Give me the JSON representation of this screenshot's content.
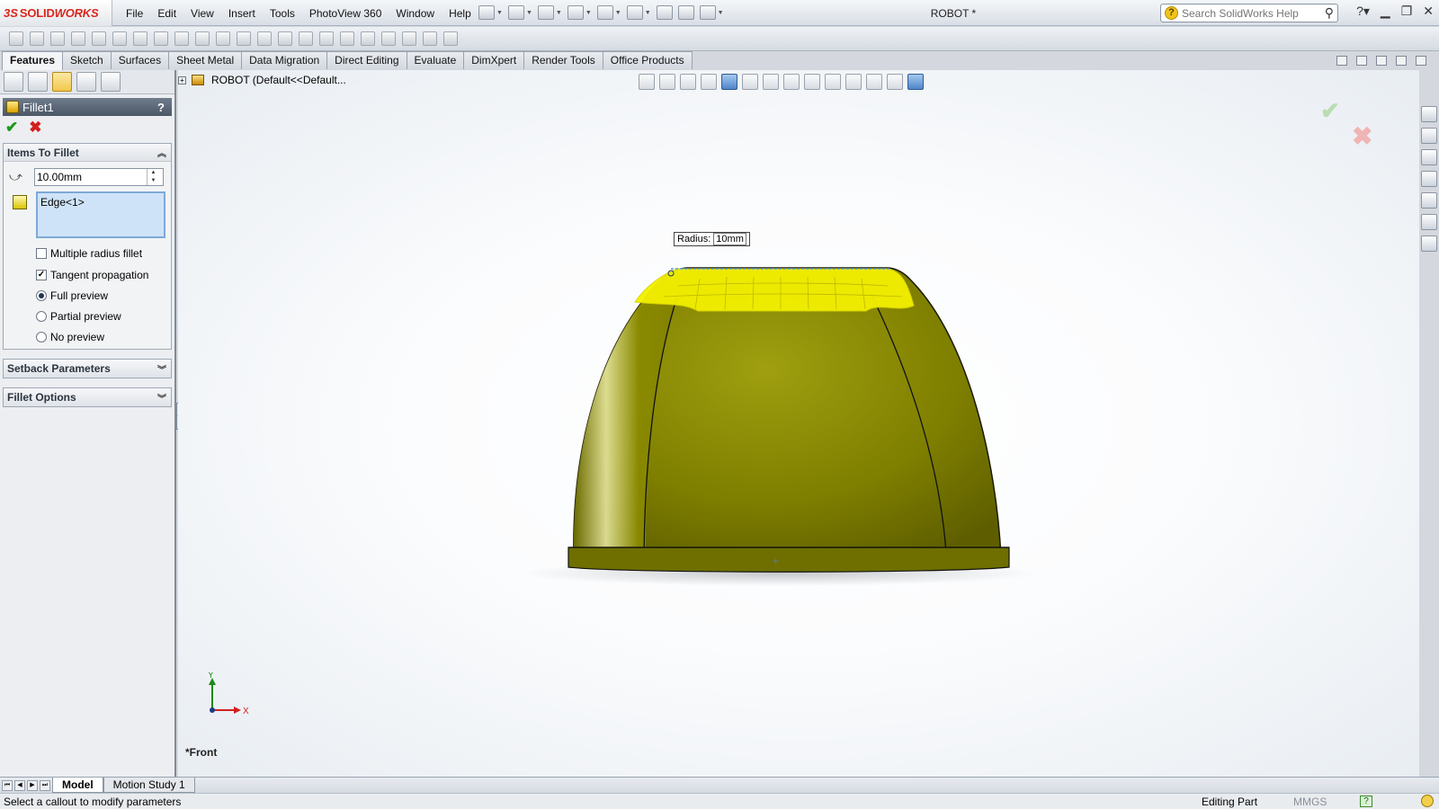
{
  "app": {
    "logo_ds": "3S",
    "logo_a": "SOLID",
    "logo_b": "WORKS",
    "doc_title": "ROBOT *"
  },
  "menu": [
    "File",
    "Edit",
    "View",
    "Insert",
    "Tools",
    "PhotoView 360",
    "Window",
    "Help"
  ],
  "search": {
    "placeholder": "Search SolidWorks Help",
    "help_icon_glyph": "?"
  },
  "tabs": [
    "Features",
    "Sketch",
    "Surfaces",
    "Sheet Metal",
    "Data Migration",
    "Direct Editing",
    "Evaluate",
    "DimXpert",
    "Render Tools",
    "Office Products"
  ],
  "active_tab": "Features",
  "property_manager": {
    "title": "Fillet1",
    "help_glyph": "?",
    "ok_glyph": "✔",
    "cancel_glyph": "✖",
    "items_group": {
      "label": "Items To Fillet",
      "radius_value": "10.00mm",
      "selection": "Edge<1>",
      "multiple_radius_label": "Multiple radius fillet",
      "multiple_radius_checked": false,
      "tangent_label": "Tangent propagation",
      "tangent_checked": true,
      "preview_options": [
        "Full preview",
        "Partial preview",
        "No preview"
      ],
      "preview_selected": "Full preview"
    },
    "setback_label": "Setback Parameters",
    "fillet_options_label": "Fillet Options"
  },
  "tree": {
    "root": "ROBOT  (Default<<Default..."
  },
  "viewport": {
    "view_name": "*Front",
    "callout_label": "Radius:",
    "callout_value": "10mm",
    "triad_x": "X",
    "triad_y": "Y",
    "ok_glyph": "✔",
    "cancel_glyph": "✖"
  },
  "bottom_tabs": [
    "Model",
    "Motion Study 1"
  ],
  "active_bottom_tab": "Model",
  "status": {
    "message": "Select a callout to modify parameters",
    "mode": "Editing Part",
    "units": "MMGS",
    "help_glyph": "?"
  },
  "colors": {
    "part": "#8f8f00",
    "preview": "#f3f000",
    "accent": "#d9261c"
  }
}
